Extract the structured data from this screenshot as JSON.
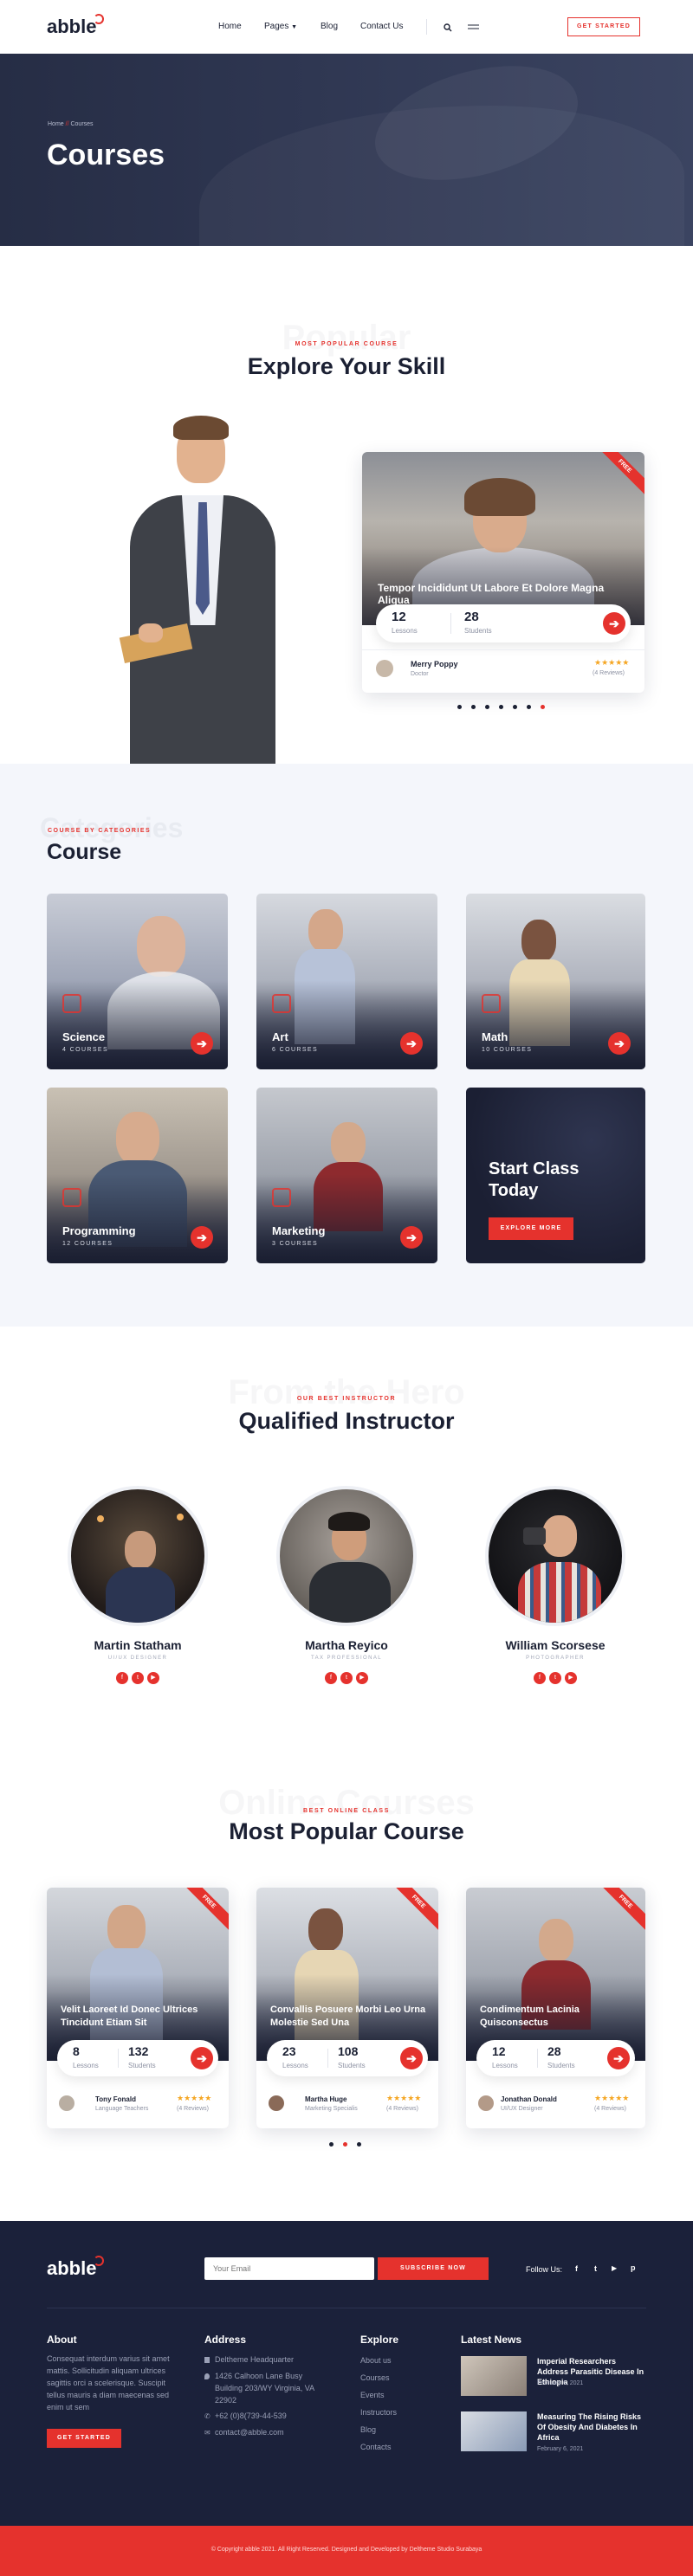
{
  "header": {
    "logo": "abble",
    "nav": [
      "Home",
      "Pages",
      "Blog",
      "Contact Us"
    ],
    "cta": "GET STARTED"
  },
  "hero": {
    "breadcrumb_home": "Home",
    "breadcrumb_sep": "//",
    "breadcrumb_current": "Courses",
    "title": "Courses"
  },
  "popular": {
    "ghost": "Popular",
    "tag": "MOST POPULAR COURSE",
    "title": "Explore Your Skill",
    "card": {
      "ribbon": "FREE",
      "title": "Tempor Incididunt Ut Labore Et Dolore Magna Aliqua",
      "lessons_value": "12",
      "lessons_label": "Lessons",
      "students_value": "28",
      "students_label": "Students",
      "author": "Merry Poppy",
      "role": "Doctor",
      "stars": "★★★★★",
      "reviews": "(4 Reviews)"
    },
    "dots_active": 7
  },
  "categories": {
    "ghost": "Categories",
    "tag": "COURSE BY CATEGORIES",
    "title": "Course",
    "items": [
      {
        "name": "Science",
        "count": "4 COURSES"
      },
      {
        "name": "Art",
        "count": "6 COURSES"
      },
      {
        "name": "Math",
        "count": "10 COURSES"
      },
      {
        "name": "Programming",
        "count": "12 COURSES"
      },
      {
        "name": "Marketing",
        "count": "3 COURSES"
      }
    ],
    "start_title_1": "Start Class",
    "start_title_2": "Today",
    "start_btn": "EXPLORE MORE"
  },
  "instructors": {
    "ghost": "From the Hero",
    "tag": "OUR BEST INSTRUCTOR",
    "title": "Qualified Instructor",
    "people": [
      {
        "name": "Martin Statham",
        "role": "UI/UX DESIGNER"
      },
      {
        "name": "Martha Reyico",
        "role": "TAX PROFESSIONAL"
      },
      {
        "name": "William Scorsese",
        "role": "PHOTOGRAPHER"
      }
    ]
  },
  "online": {
    "ghost": "Online Courses",
    "tag": "BEST ONLINE CLASS",
    "title": "Most Popular Course",
    "cards": [
      {
        "ribbon": "FREE",
        "title": "Velit Laoreet Id Donec Ultrices Tincidunt Etiam Sit",
        "lessons": "8",
        "students": "132",
        "author": "Tony Fonald",
        "role": "Language Teachers",
        "reviews": "(4 Reviews)"
      },
      {
        "ribbon": "FREE",
        "title": "Convallis Posuere Morbi Leo Urna Molestie Sed Una",
        "lessons": "23",
        "students": "108",
        "author": "Martha Huge",
        "role": "Marketing Specialis",
        "reviews": "(4 Reviews)"
      },
      {
        "ribbon": "FREE",
        "title": "Condimentum Lacinia Quisconsectus",
        "lessons": "12",
        "students": "28",
        "author": "Jonathan Donald",
        "role": "UI/UX Designer",
        "reviews": "(4 Reviews)"
      }
    ],
    "lessons_label": "Lessons",
    "students_label": "Students",
    "stars": "★★★★★"
  },
  "footer": {
    "logo": "abble",
    "email_placeholder": "Your Email",
    "subscribe": "SUBSCRIBE NOW",
    "follow": "Follow Us:",
    "about_h": "About",
    "about_text": "Consequat interdum varius sit amet mattis. Sollicitudin aliquam ultrices sagittis orci a scelerisque. Suscipit tellus mauris a diam maecenas sed enim ut sem",
    "about_btn": "GET STARTED",
    "address_h": "Address",
    "address_1": "Deltheme Headquarter",
    "address_2": "1426 Calhoon Lane Busy Building 203/WY Virginia, VA 22902",
    "phone": "+62 (0)8(739-44-539",
    "email": "contact@abble.com",
    "explore_h": "Explore",
    "explore": [
      "About us",
      "Courses",
      "Events",
      "Instructors",
      "Blog",
      "Contacts"
    ],
    "news_h": "Latest News",
    "news": [
      {
        "title": "Imperial Researchers Address Parasitic Disease In Ethiopia",
        "date": "February 6, 2021"
      },
      {
        "title": "Measuring The Rising Risks Of Obesity And Diabetes In Africa",
        "date": "February 6, 2021"
      }
    ],
    "copyright": "© Copyright abble 2021. All Right Reserved. Designed and Developed by Deltheme Studio Surabaya"
  }
}
